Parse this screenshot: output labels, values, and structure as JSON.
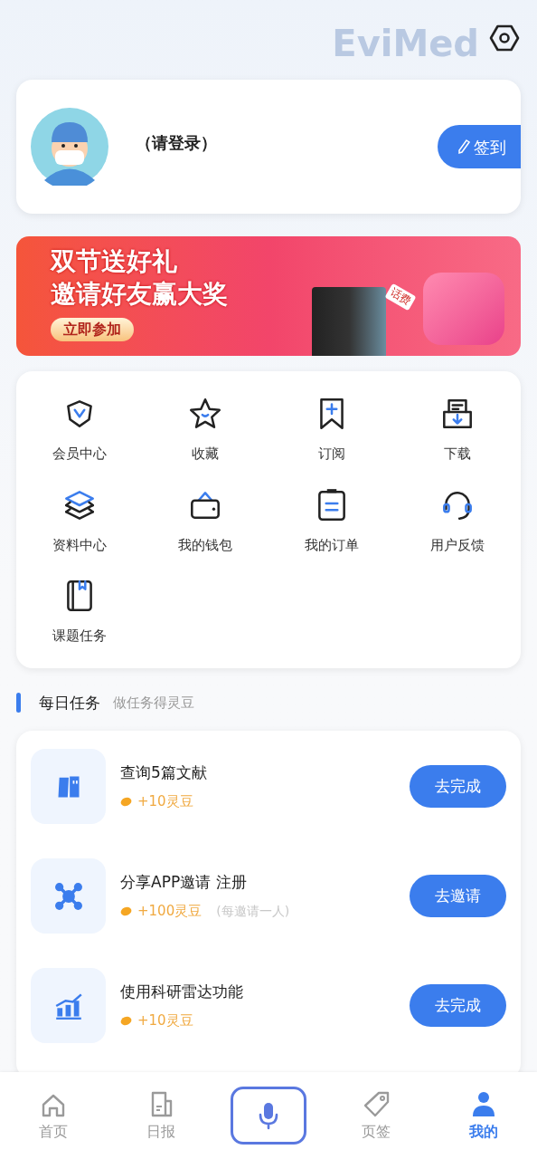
{
  "header": {
    "brand_text": "EviMed"
  },
  "profile": {
    "login_prompt": "（请登录）",
    "checkin_button": "签到"
  },
  "banner": {
    "line_1": "双节送好礼",
    "line_2": "邀请好友赢大奖",
    "button": "立即参加",
    "tag": "话费"
  },
  "shortcuts": [
    {
      "kind": "vip",
      "label": "会员中心"
    },
    {
      "kind": "star",
      "label": "收藏"
    },
    {
      "kind": "subscribe",
      "label": "订阅"
    },
    {
      "kind": "download",
      "label": "下载"
    },
    {
      "kind": "layers",
      "label": "资料中心"
    },
    {
      "kind": "wallet",
      "label": "我的钱包"
    },
    {
      "kind": "order",
      "label": "我的订单"
    },
    {
      "kind": "headset",
      "label": "用户反馈"
    },
    {
      "kind": "notebook",
      "label": "课题任务"
    }
  ],
  "daily_tasks": {
    "title": "每日任务",
    "subtitle": "做任务得灵豆",
    "items": [
      {
        "kind": "books",
        "title": "查询5篇文献",
        "reward": "+10灵豆",
        "button": "去完成"
      },
      {
        "kind": "network",
        "title": "分享APP邀请 注册",
        "reward": "+100灵豆",
        "note": "(每邀请一人)",
        "button": "去邀请"
      },
      {
        "kind": "chart",
        "title": "使用科研雷达功能",
        "reward": "+10灵豆",
        "button": "去完成"
      }
    ]
  },
  "bottom_nav": [
    {
      "kind": "home",
      "label": "首页",
      "selected": false
    },
    {
      "kind": "news",
      "label": "日报",
      "selected": false
    },
    {
      "kind": "mic",
      "selected": false
    },
    {
      "kind": "tag",
      "label": "页签",
      "selected": false
    },
    {
      "kind": "user",
      "label": "我的",
      "selected": true
    }
  ]
}
